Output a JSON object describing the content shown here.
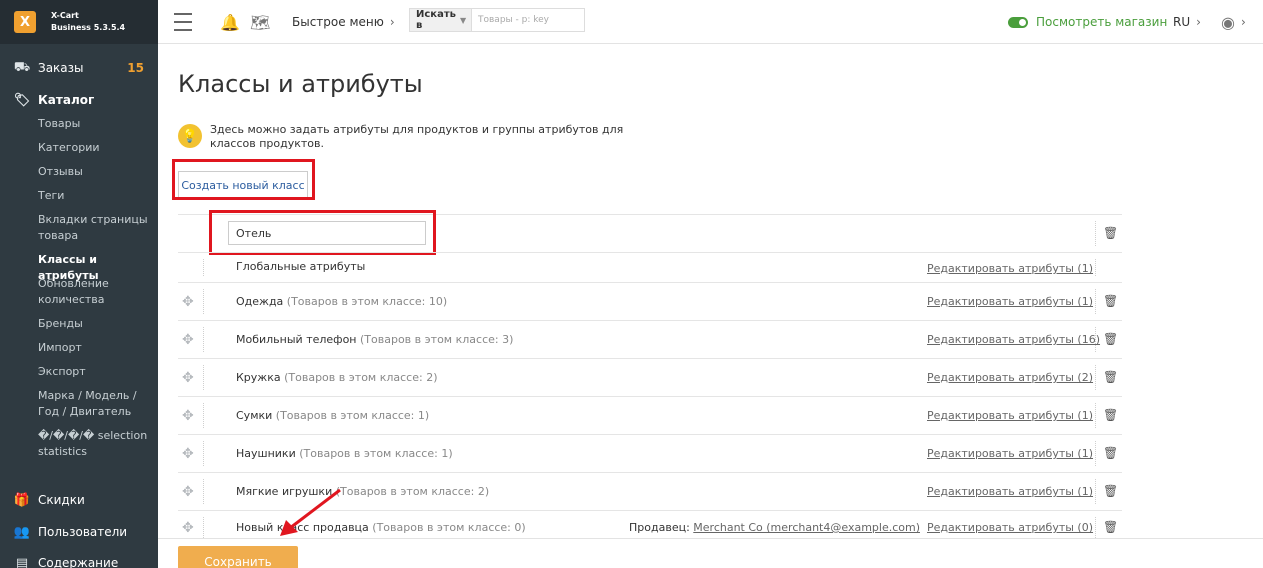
{
  "brand": {
    "line1": "X-Cart",
    "line2": "Business 5.3.5.4",
    "logo": "X"
  },
  "sidebar": {
    "orders": {
      "label": "Заказы",
      "badge": "15"
    },
    "catalog": {
      "label": "Каталог"
    },
    "items": [
      "Товары",
      "Категории",
      "Отзывы",
      "Теги",
      "Вкладки страницы товара",
      "Классы и атрибуты",
      "Обновление количества",
      "Бренды",
      "Импорт",
      "Экспорт",
      "Марка / Модель / Год / Двигатель",
      "�/�/�/� selection statistics"
    ],
    "discounts": "Скидки",
    "users": "Пользователи",
    "content": "Содержание"
  },
  "topbar": {
    "quick_menu": "Быстрое меню",
    "search_in": "Искать в",
    "search_placeholder": "Товары - p: key",
    "view_store": "Посмотреть магазин",
    "lang": "RU"
  },
  "main": {
    "title": "Классы и атрибуты",
    "hint": "Здесь можно задать атрибуты для продуктов и группы атрибутов для классов продуктов.",
    "create_button": "Создать новый класс",
    "new_class_value": "Отель",
    "global": {
      "name": "Глобальные атрибуты",
      "edit": "Редактировать атрибуты (1)"
    },
    "rows": [
      {
        "name": "Одежда",
        "count": "(Товаров в этом классе: 10)",
        "edit": "Редактировать атрибуты (1)"
      },
      {
        "name": "Мобильный телефон",
        "count": "(Товаров в этом классе: 3)",
        "edit": "Редактировать атрибуты (16)"
      },
      {
        "name": "Кружка",
        "count": "(Товаров в этом классе: 2)",
        "edit": "Редактировать атрибуты (2)"
      },
      {
        "name": "Сумки",
        "count": "(Товаров в этом классе: 1)",
        "edit": "Редактировать атрибуты (1)"
      },
      {
        "name": "Наушники",
        "count": "(Товаров в этом классе: 1)",
        "edit": "Редактировать атрибуты (1)"
      },
      {
        "name": "Мягкие игрушки",
        "count": "(Товаров в этом классе: 2)",
        "edit": "Редактировать атрибуты (1)"
      },
      {
        "name": "Новый класс продавца",
        "count": "(Товаров в этом классе: 0)",
        "edit": "Редактировать атрибуты (0)",
        "seller_label": "Продавец:",
        "seller_link": "Merchant Co (merchant4@example.com)"
      }
    ],
    "save_button": "Сохранить"
  },
  "colors": {
    "accent": "#f0ad4e",
    "sidebar": "#2f3a41",
    "highlight": "#e0161f",
    "store": "#4a9e3c"
  }
}
